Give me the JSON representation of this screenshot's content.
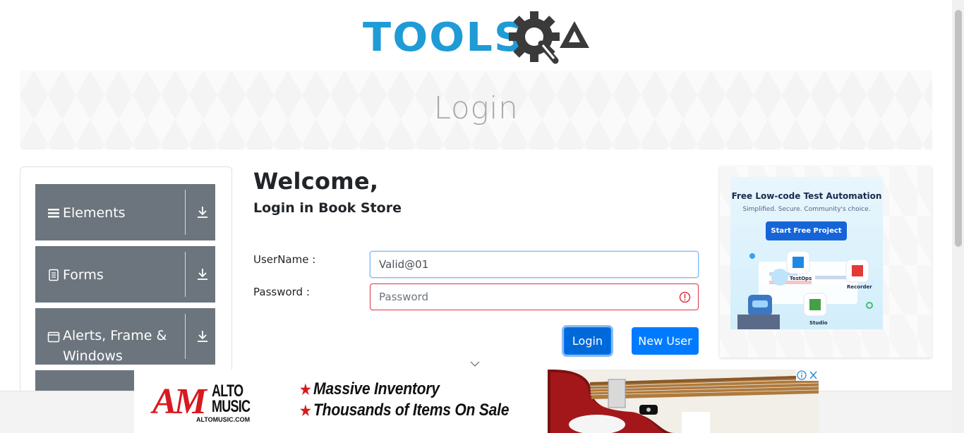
{
  "header": {
    "logo_text": "TOOLS",
    "logo_suffix": "QA"
  },
  "banner": {
    "title": "Login"
  },
  "sidebar": {
    "groups": [
      {
        "label": "Elements",
        "icon": "menu-icon"
      },
      {
        "label": "Forms",
        "icon": "document-icon"
      },
      {
        "label": "Alerts, Frame & Windows",
        "icon": "window-icon"
      },
      {
        "label": "",
        "icon": ""
      }
    ]
  },
  "form": {
    "welcome": "Welcome,",
    "subtitle": "Login in Book Store",
    "username_label": "UserName :",
    "username_value": "Valid@01",
    "password_label": "Password :",
    "password_placeholder": "Password",
    "login_button": "Login",
    "new_user_button": "New User"
  },
  "side_ad": {
    "title": "Free Low-code Test Automation",
    "subtitle": "Simplified. Secure. Community's choice.",
    "cta": "Start Free Project",
    "labels": [
      "TestOps",
      "Recorder",
      "Studio"
    ]
  },
  "bottom_ad": {
    "brand_letters": "AM",
    "brand_line1": "ALTO",
    "brand_line2": "MUSIC",
    "brand_url": "ALTOMUSIC.COM",
    "line1": "Massive Inventory",
    "line2": "Thousands of Items On Sale"
  },
  "colors": {
    "primary": "#007bff",
    "logo_blue": "#1f9bd6",
    "sidebar": "#6c757d",
    "error": "#dc3545",
    "brand_red": "#d71920"
  }
}
